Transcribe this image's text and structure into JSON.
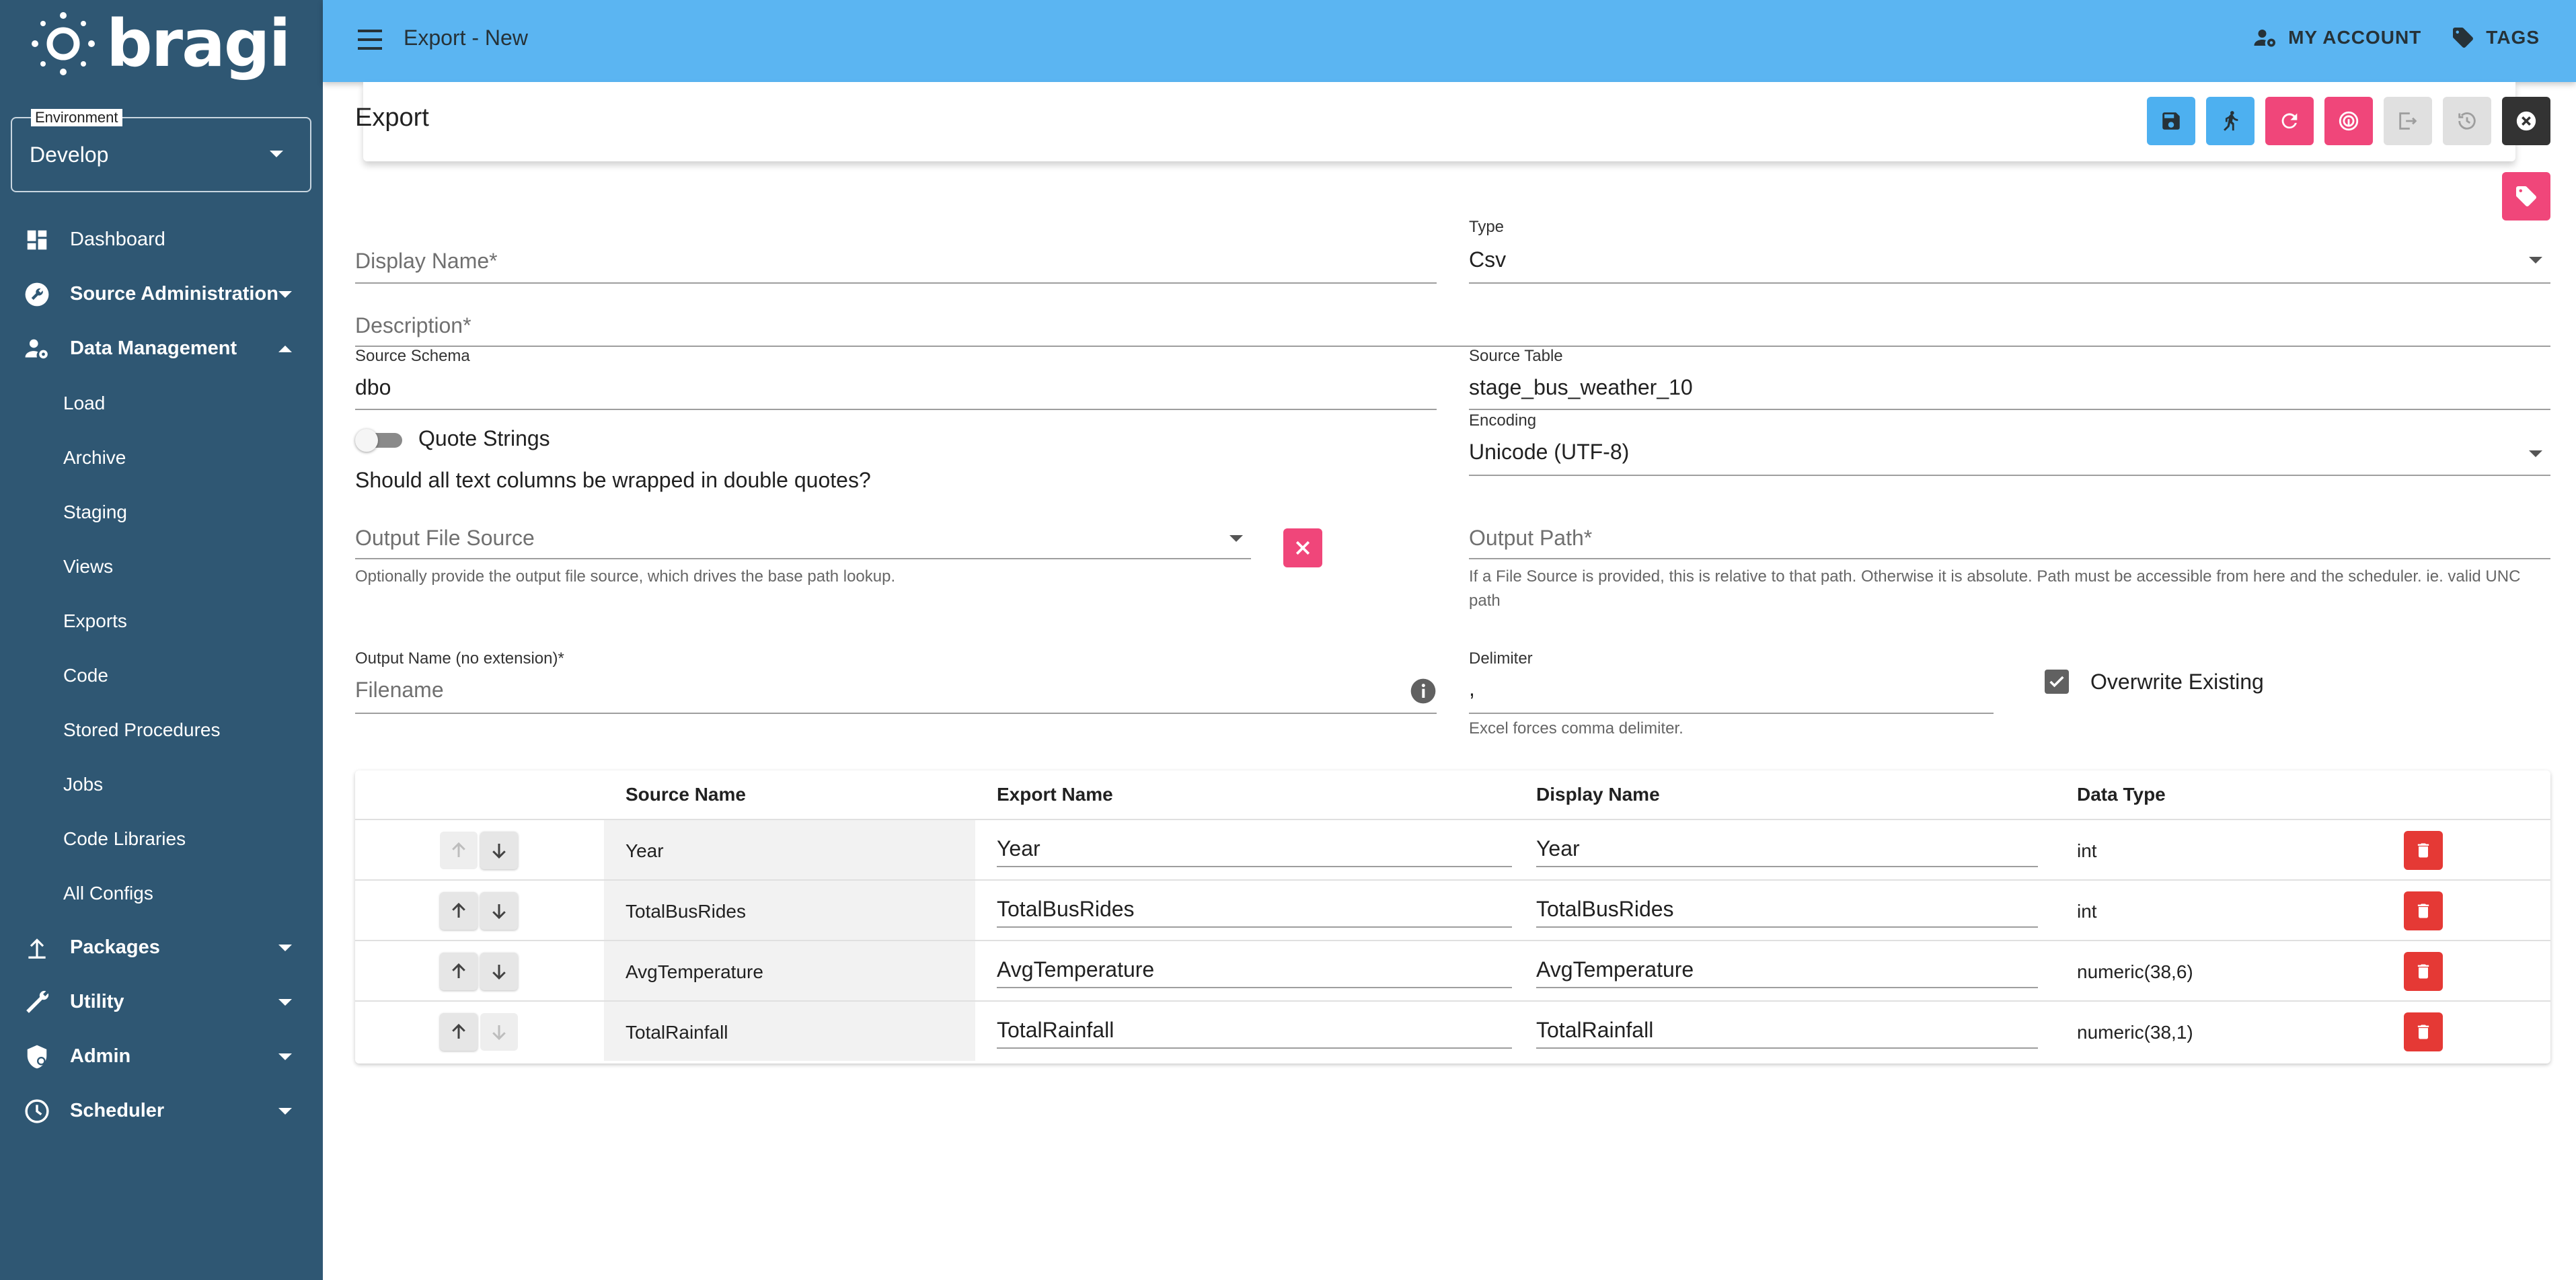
{
  "app": {
    "logo_text": "bragi"
  },
  "environment": {
    "label": "Environment",
    "value": "Develop"
  },
  "nav": {
    "dashboard": "Dashboard",
    "source_administration": "Source Administration",
    "data_management": "Data Management",
    "sub_items": [
      "Load",
      "Archive",
      "Staging",
      "Views",
      "Exports",
      "Code",
      "Stored Procedures",
      "Jobs",
      "Code Libraries",
      "All Configs"
    ],
    "packages": "Packages",
    "utility": "Utility",
    "admin": "Admin",
    "scheduler": "Scheduler"
  },
  "topbar": {
    "title": "Export - New",
    "my_account": "MY ACCOUNT",
    "tags": "TAGS"
  },
  "header": {
    "title": "Export"
  },
  "colors": {
    "topbar": "#5bb5f2",
    "sidebar": "#2f5773",
    "blue_button": "#4db0f0",
    "pink_button": "#f0467a",
    "dark_button": "#333333",
    "delete_red": "#e53935"
  },
  "form": {
    "display_name": {
      "placeholder": "Display Name*"
    },
    "type": {
      "label": "Type",
      "value": "Csv"
    },
    "description": {
      "placeholder": "Description*"
    },
    "source_schema": {
      "label": "Source Schema",
      "value": "dbo"
    },
    "source_table": {
      "label": "Source Table",
      "value": "stage_bus_weather_10"
    },
    "quote_strings": {
      "label": "Quote Strings",
      "question": "Should all text columns be wrapped in double quotes?"
    },
    "encoding": {
      "label": "Encoding",
      "value": "Unicode (UTF-8)"
    },
    "output_file_source": {
      "placeholder": "Output File Source",
      "hint": "Optionally provide the output file source, which drives the base path lookup."
    },
    "output_path": {
      "placeholder": "Output Path*",
      "hint": "If a File Source is provided, this is relative to that path. Otherwise it is absolute. Path must be accessible from here and the scheduler. ie. valid UNC path"
    },
    "output_name": {
      "label": "Output Name (no extension)*",
      "placeholder": "Filename"
    },
    "delimiter": {
      "label": "Delimiter",
      "value": ",",
      "hint": "Excel forces comma delimiter."
    },
    "overwrite_existing": {
      "label": "Overwrite Existing",
      "checked": true
    }
  },
  "table": {
    "headers": {
      "source_name": "Source Name",
      "export_name": "Export Name",
      "display_name": "Display Name",
      "data_type": "Data Type"
    },
    "rows": [
      {
        "source": "Year",
        "export": "Year",
        "display": "Year",
        "type": "int"
      },
      {
        "source": "TotalBusRides",
        "export": "TotalBusRides",
        "display": "TotalBusRides",
        "type": "int"
      },
      {
        "source": "AvgTemperature",
        "export": "AvgTemperature",
        "display": "AvgTemperature",
        "type": "numeric(38,6)"
      },
      {
        "source": "TotalRainfall",
        "export": "TotalRainfall",
        "display": "TotalRainfall",
        "type": "numeric(38,1)"
      }
    ]
  }
}
